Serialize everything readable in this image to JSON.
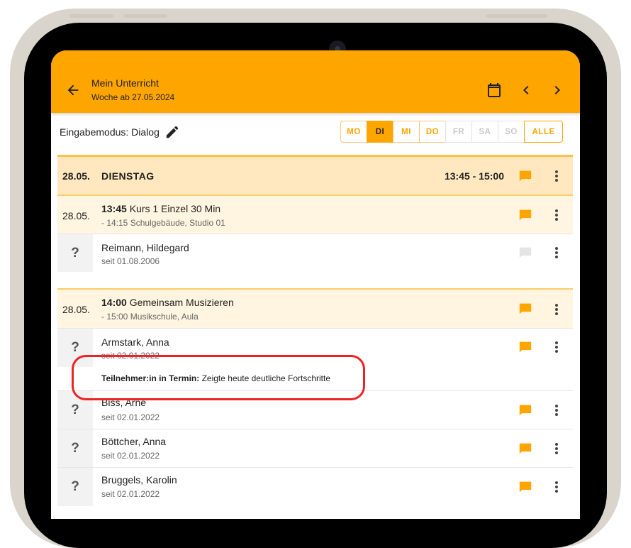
{
  "app": {
    "title": "Mein Unterricht",
    "subtitle": "Woche ab 27.05.2024",
    "accent_color": "#ffa500",
    "icons": [
      "back-arrow-icon",
      "calendar-icon",
      "chevron-left-icon",
      "chevron-right-icon"
    ]
  },
  "mode": {
    "label": "Eingabemodus: Dialog",
    "edit_icon": "pencil-icon"
  },
  "days": {
    "items": [
      "MO",
      "DI",
      "MI",
      "DO",
      "FR",
      "SA",
      "SO"
    ],
    "selected": "DI",
    "disabled": [
      "FR",
      "SA",
      "SO"
    ],
    "all_label": "ALLE"
  },
  "day_header": {
    "date": "28.05.",
    "name": "DIENSTAG",
    "time": "13:45 - 15:00"
  },
  "courses": [
    {
      "date": "28.05.",
      "time": "13:45",
      "name": "Kurs 1 Einzel 30 Min",
      "detail": "- 14:15 Schulgebäude, Studio 01",
      "participants": [
        {
          "placeholder": "?",
          "name": "Reimann, Hildegard",
          "since": "seit 01.08.2006",
          "has_comment": false
        }
      ]
    },
    {
      "date": "28.05.",
      "time": "14:00",
      "name": "Gemeinsam Musizieren",
      "detail": "- 15:00 Musikschule, Aula",
      "participants": [
        {
          "placeholder": "?",
          "name": "Armstark, Anna",
          "since": "seit 02.01.2022",
          "has_comment": true,
          "note_label": "Teilnehmer:in in Termin:",
          "note_text": "Zeigte heute deutliche Fortschritte"
        },
        {
          "placeholder": "?",
          "name": "Biss, Arne",
          "since": "seit 02.01.2022",
          "has_comment": true
        },
        {
          "placeholder": "?",
          "name": "Böttcher, Anna",
          "since": "seit 02.01.2022",
          "has_comment": true
        },
        {
          "placeholder": "?",
          "name": "Bruggels, Karolin",
          "since": "seit 02.01.2022",
          "has_comment": true
        }
      ]
    }
  ],
  "colors": {
    "comment_active": "#ffa500",
    "comment_inactive": "#e4e4e4",
    "highlight": "#ee2222"
  }
}
